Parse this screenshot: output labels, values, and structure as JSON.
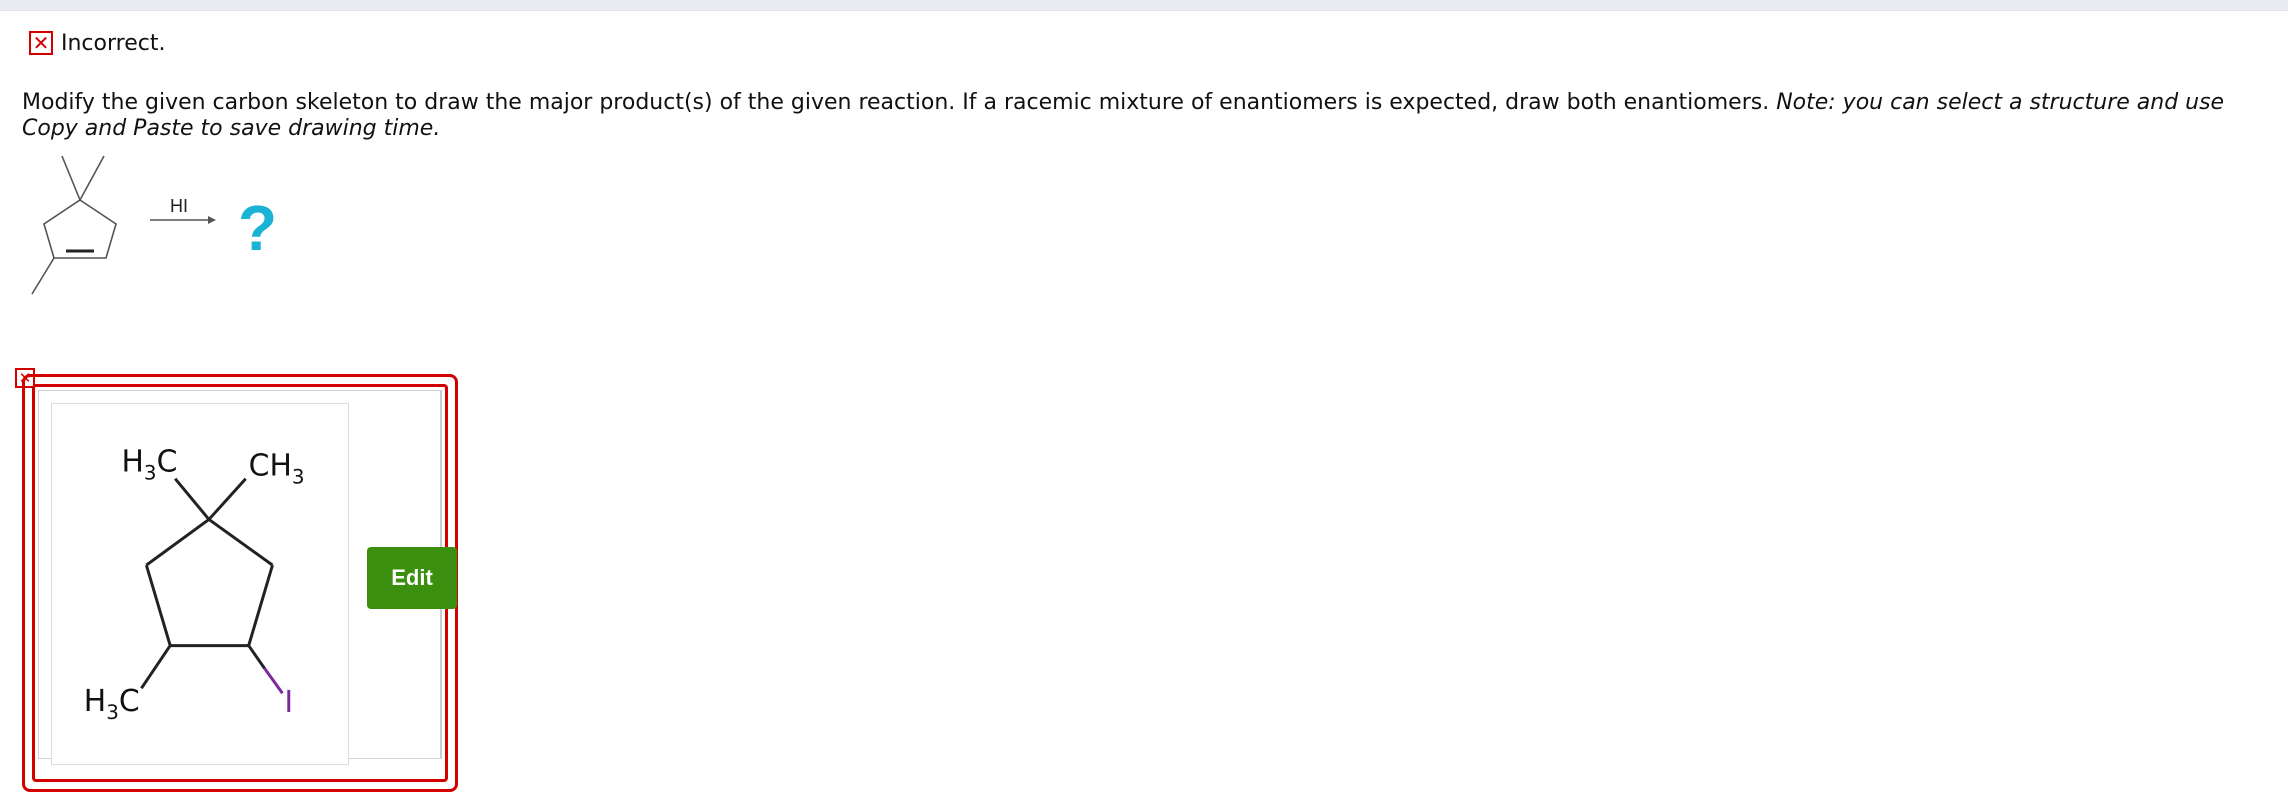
{
  "feedback": {
    "status_label": "Incorrect."
  },
  "question": {
    "prompt_main": "Modify the given carbon skeleton to draw the major product(s) of the given reaction. If a racemic mixture of enantiomers is expected, draw both enantiomers.",
    "prompt_note": "Note: you can select a structure and use Copy and Paste to save drawing time."
  },
  "reaction": {
    "reagent": "HI",
    "unknown_product": "?"
  },
  "answer": {
    "edit_label": "Edit",
    "atoms": {
      "top_left_methyl_main": "H",
      "top_left_methyl_sub": "3",
      "top_left_methyl_tail": "C",
      "top_right_methyl_main": "CH",
      "top_right_methyl_sub": "3",
      "bottom_left_methyl_main": "H",
      "bottom_left_methyl_sub": "3",
      "bottom_left_methyl_tail": "C",
      "iodine": "I"
    }
  },
  "colors": {
    "error_red": "#d40000",
    "edit_green": "#3a8f0f",
    "question_mark_cyan": "#1ab3d6",
    "iodine_purple": "#7b2a9b"
  }
}
